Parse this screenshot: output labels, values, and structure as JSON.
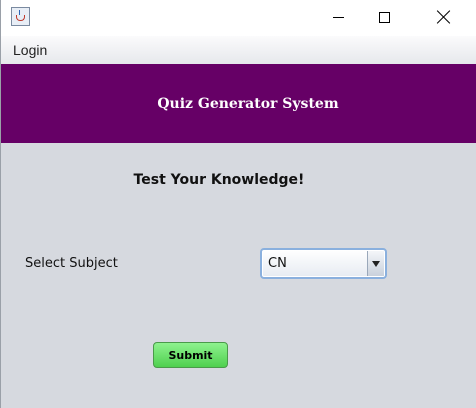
{
  "window": {
    "controls": [
      "minimize",
      "maximize",
      "close"
    ],
    "icon": "java-app-icon"
  },
  "menubar": {
    "items": [
      {
        "label": "Login"
      }
    ]
  },
  "header": {
    "title": "Quiz Generator System",
    "background_color": "#660066",
    "text_color": "#ffffff"
  },
  "main": {
    "subtitle": "Test Your Knowledge!",
    "subject_label": "Select Subject",
    "subject_select": {
      "selected": "CN"
    },
    "submit_label": "Submit",
    "submit_color": "#5fd85f"
  }
}
